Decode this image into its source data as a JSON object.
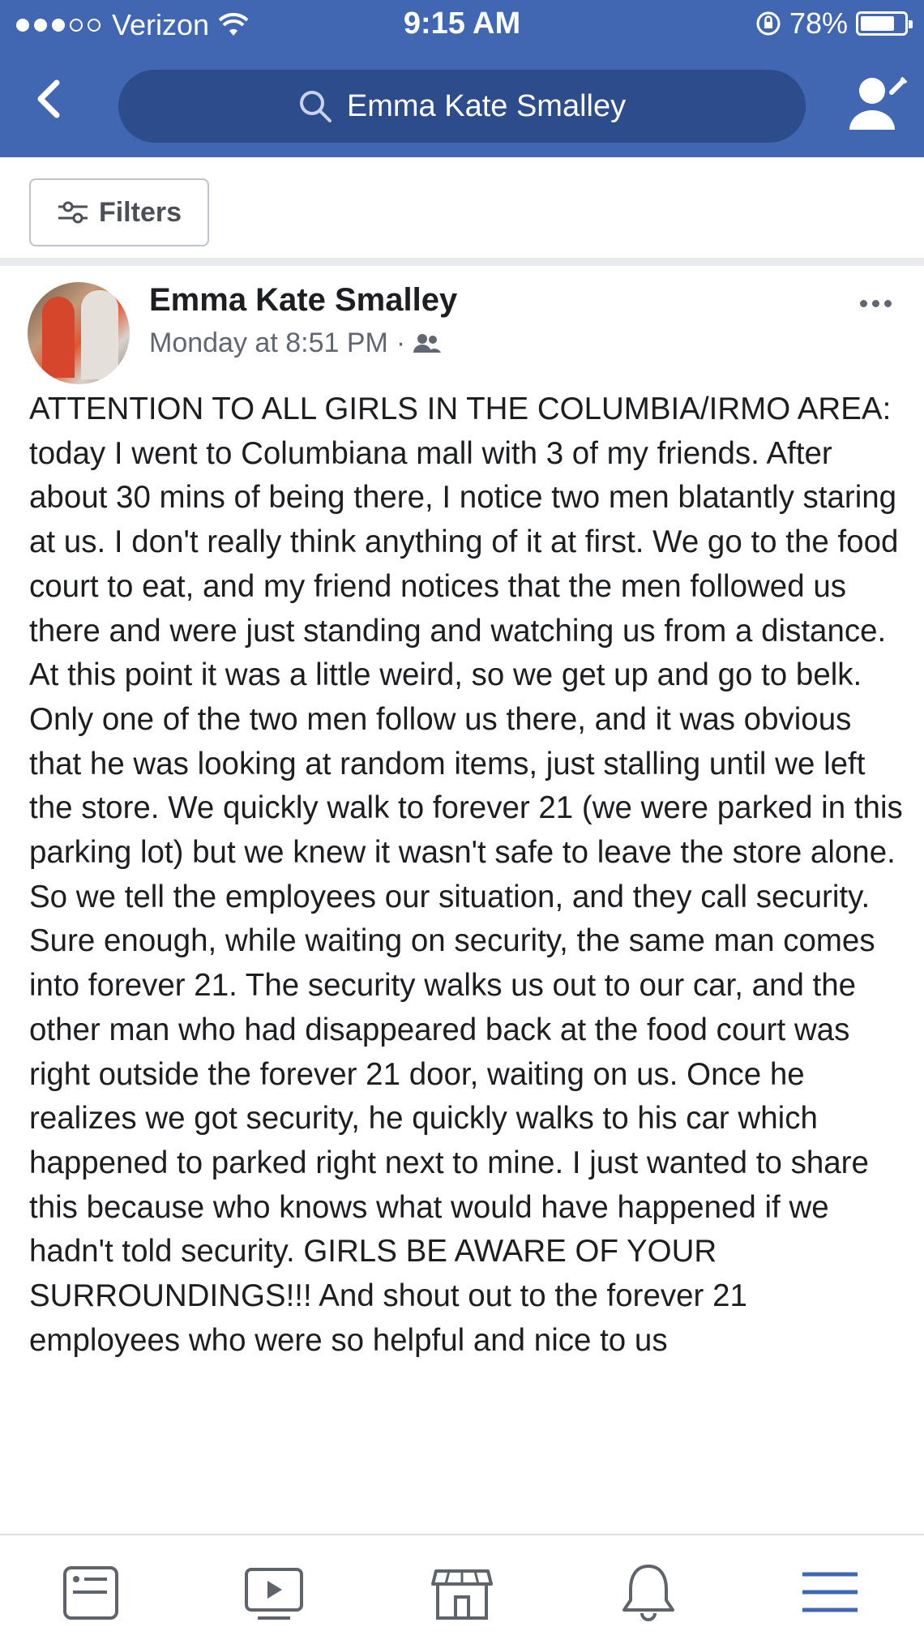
{
  "status_bar": {
    "carrier": "Verizon",
    "time": "9:15 AM",
    "battery": "78%",
    "battery_level": 0.78,
    "signal_dots": 3,
    "signal_total": 5
  },
  "nav": {
    "search_query": "Emma Kate Smalley",
    "accent_color": "#4267b2"
  },
  "filters": {
    "label": "Filters"
  },
  "post": {
    "author": "Emma Kate Smalley",
    "timestamp": "Monday at 8:51 PM",
    "separator": "·",
    "body": "ATTENTION TO ALL GIRLS IN THE COLUMBIA/IRMO AREA: today I went to Columbiana mall with 3 of my friends. After about 30 mins of being there, I notice two men blatantly staring at us. I don't really think anything of it at first. We go to the food court to eat, and my friend notices that the men followed us there and were just standing and watching us from a distance. At this point it was a little weird, so we get up and go to belk. Only one of the two men follow us there, and it was obvious that he was looking at random items, just stalling until we left the store. We quickly walk to forever 21 (we were parked in this parking lot) but we knew it wasn't safe to leave the store alone. So we tell the employees our situation, and they call security. Sure enough, while waiting on security, the same man comes into forever 21. The security walks us out to our car, and the other man who had disappeared back at the food court was right outside the forever 21 door, waiting on us. Once he realizes we got security, he quickly walks to his car which happened to parked right next to mine. I just wanted to share this because who knows what would have happened if we hadn't told security. GIRLS BE AWARE OF YOUR SURROUNDINGS!!! And shout out to the forever 21 employees who were so helpful and nice to us"
  },
  "tabs": [
    {
      "icon": "news-feed-icon"
    },
    {
      "icon": "video-icon"
    },
    {
      "icon": "marketplace-icon"
    },
    {
      "icon": "notifications-bell-icon"
    },
    {
      "icon": "menu-icon",
      "active": true
    }
  ]
}
